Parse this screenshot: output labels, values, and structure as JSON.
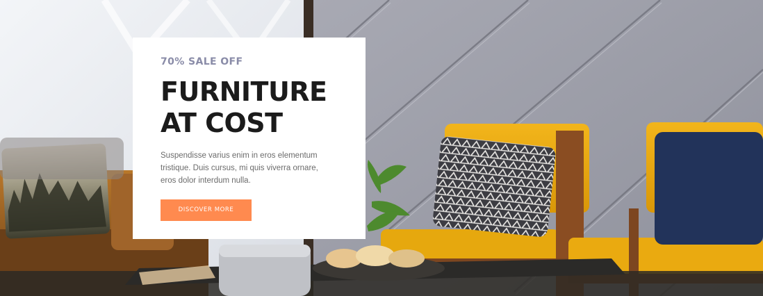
{
  "hero": {
    "eyebrow": "70% SALE OFF",
    "title_line1": "FURNITURE",
    "title_line2": "AT COST",
    "description": "Suspendisse varius enim in eros elementum tristique. Duis cursus, mi quis viverra ornare, eros dolor interdum nulla.",
    "cta_label": "DISCOVER MORE"
  },
  "colors": {
    "accent": "#ff8a4f",
    "eyebrow": "#8a8ca8",
    "title": "#1b1b1b",
    "card_bg": "#ffffff"
  }
}
